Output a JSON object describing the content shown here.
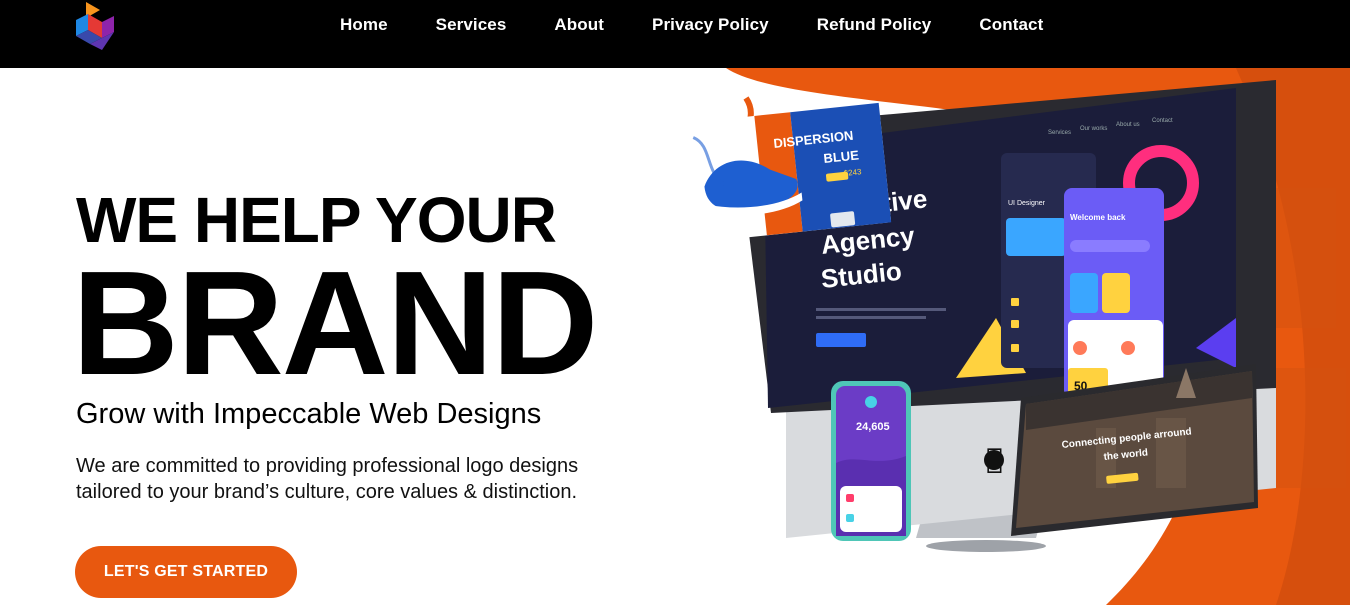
{
  "nav": {
    "items": [
      "Home",
      "Services",
      "About",
      "Privacy Policy",
      "Refund Policy",
      "Contact"
    ]
  },
  "hero": {
    "line1": "WE HELP YOUR",
    "line2": "BRAND",
    "subtitle": "Grow with Impeccable Web Designs",
    "description": "We are committed to providing professional logo designs tailored to your brand’s culture, core values & distinction.",
    "cta_label": "LET'S GET STARTED"
  },
  "mockup": {
    "card_title_1": "DISPERSION",
    "card_title_2": "BLUE",
    "card_price": "$243",
    "screen_title_1": "Creative",
    "screen_title_2": "Agency",
    "screen_title_3": "Studio",
    "screen_nav": [
      "Services",
      "Our works",
      "About us",
      "Contact"
    ],
    "app_welcome": "Welcome back",
    "app_designer": "UI Designer",
    "phone_value": "24,605",
    "laptop_title_1": "Connecting people arround",
    "laptop_title_2": "the world",
    "badge_value": "50"
  },
  "colors": {
    "accent": "#e8580f",
    "nav_bg": "#000000",
    "screen_bg": "#1b1d3a"
  }
}
